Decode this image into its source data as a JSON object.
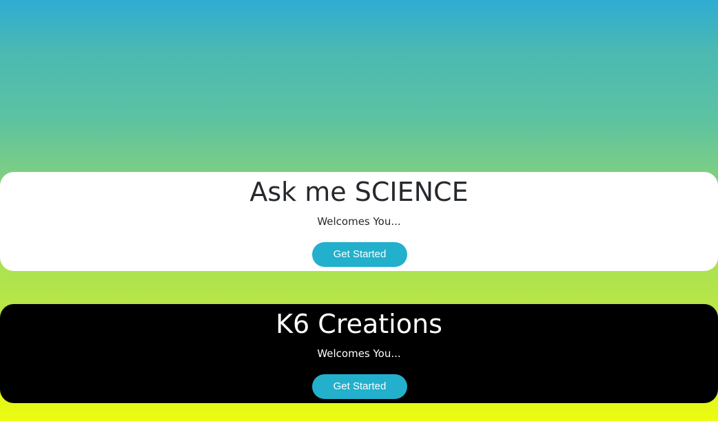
{
  "colors": {
    "gradient_top": "#2eacd3",
    "gradient_bottom": "#edfd10",
    "button": "#22b0cc",
    "card_light_bg": "#ffffff",
    "card_dark_bg": "#000000"
  },
  "cards": [
    {
      "title": "Ask me SCIENCE",
      "subtitle": "Welcomes You...",
      "button_label": "Get Started"
    },
    {
      "title": "K6 Creations",
      "subtitle": "Welcomes You...",
      "button_label": "Get Started"
    }
  ]
}
